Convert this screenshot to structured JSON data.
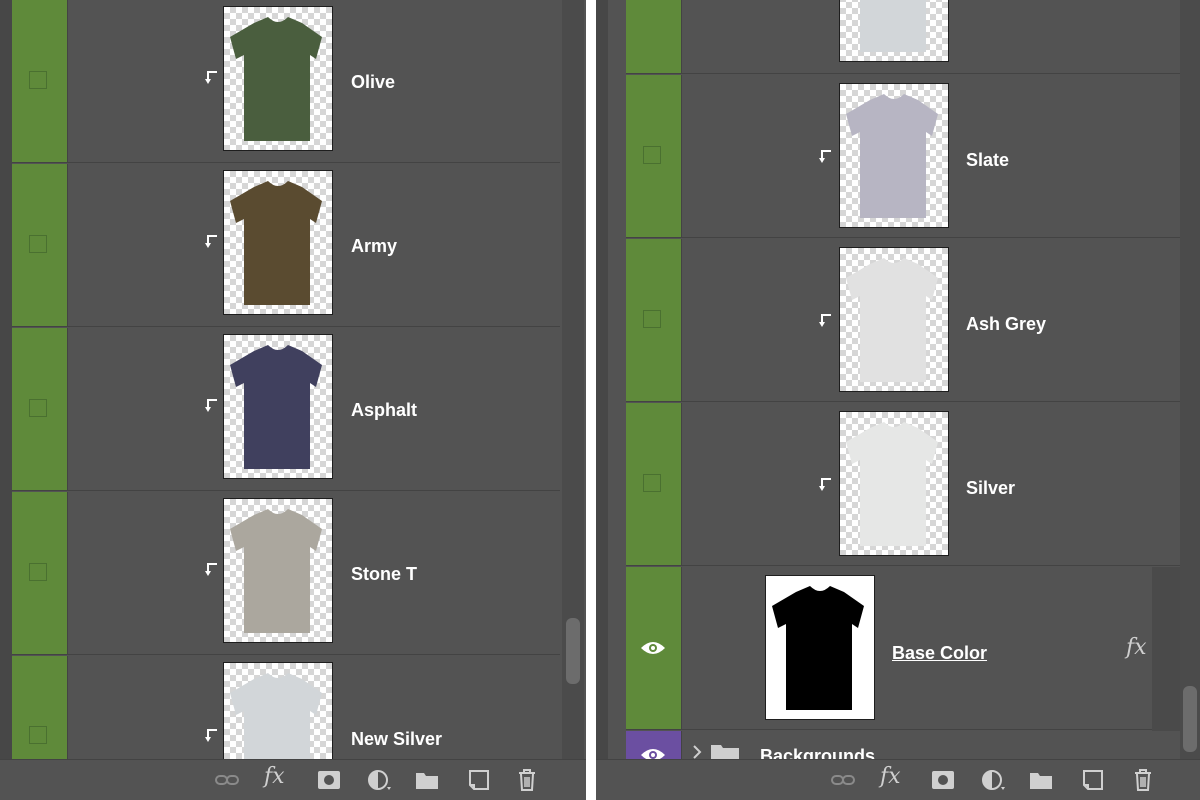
{
  "left_panel": {
    "layers": [
      {
        "name": "Olive",
        "shirt_color": "#4a5e3e",
        "visible": false,
        "clipped": true
      },
      {
        "name": "Army",
        "shirt_color": "#5a4b30",
        "visible": false,
        "clipped": true
      },
      {
        "name": "Asphalt",
        "shirt_color": "#40405e",
        "visible": false,
        "clipped": true
      },
      {
        "name": "Stone T",
        "shirt_color": "#aba79e",
        "visible": false,
        "clipped": true
      },
      {
        "name": "New Silver",
        "shirt_color": "#d2d6d9",
        "visible": false,
        "clipped": true
      }
    ],
    "footer_tools": [
      "link-icon",
      "fx-icon",
      "mask-icon",
      "adjustment-icon",
      "folder-icon",
      "new-layer-icon",
      "trash-icon"
    ],
    "fx_label": "fx"
  },
  "right_panel": {
    "layers": [
      {
        "name": "",
        "shirt_color": "#d2d6d9",
        "visible": false,
        "clipped": false
      },
      {
        "name": "Slate",
        "shirt_color": "#b7b5c3",
        "visible": false,
        "clipped": true
      },
      {
        "name": "Ash Grey",
        "shirt_color": "#e1e1e1",
        "visible": false,
        "clipped": true
      },
      {
        "name": "Silver",
        "shirt_color": "#e6e7e6",
        "visible": false,
        "clipped": true
      },
      {
        "name": "Base Color",
        "shirt_color": "#000000",
        "visible": true,
        "clipped": false,
        "fx": "fx"
      }
    ],
    "group": {
      "name": "Backgrounds",
      "visible": true
    },
    "footer_tools": [
      "link-icon",
      "fx-icon",
      "mask-icon",
      "adjustment-icon",
      "folder-icon",
      "new-layer-icon",
      "trash-icon"
    ],
    "fx_label": "fx"
  },
  "colors": {
    "panel_bg": "#535353",
    "visibility_green": "#5f8a3a",
    "visibility_purple": "#6b4fa1"
  }
}
